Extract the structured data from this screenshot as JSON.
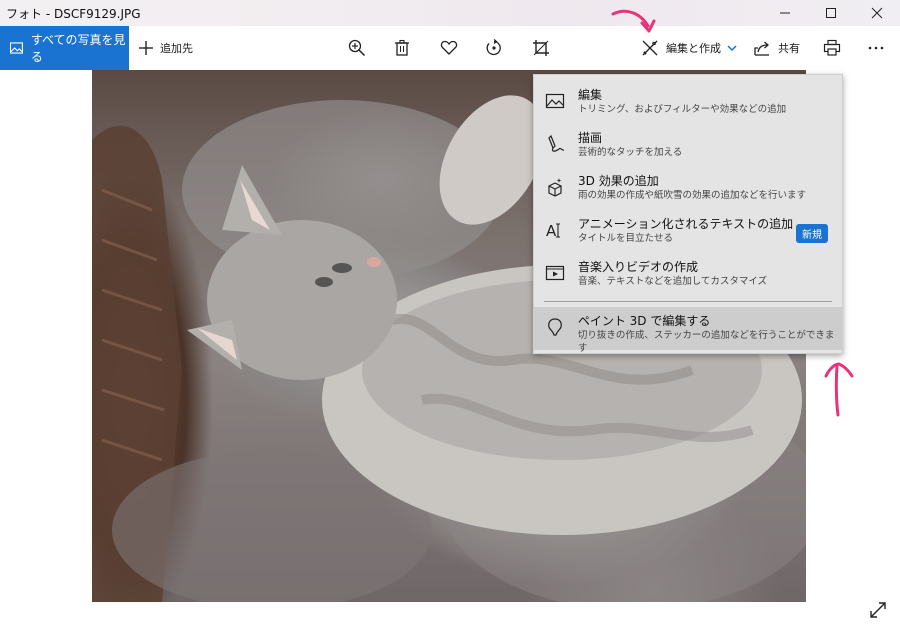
{
  "window": {
    "title": "フォト - DSCF9129.JPG",
    "minimize_icon": "minimize-icon",
    "maximize_icon": "maximize-icon",
    "close_icon": "close-icon"
  },
  "toolbar": {
    "all_photos_label": "すべての写真を見る",
    "add_to_label": "追加先",
    "edit_create_label": "編集と作成",
    "share_label": "共有",
    "icons": [
      "zoom-in-icon",
      "delete-icon",
      "heart-icon",
      "rotate-icon",
      "crop-icon",
      "print-icon",
      "more-icon"
    ]
  },
  "menu": {
    "items": [
      {
        "title": "編集",
        "desc": "トリミング、およびフィルターや効果などの追加",
        "icon": "edit-photo-icon"
      },
      {
        "title": "描画",
        "desc": "芸術的なタッチを加える",
        "icon": "draw-icon"
      },
      {
        "title": "3D 効果の追加",
        "desc": "雨の効果の作成や紙吹雪の効果の追加などを行います",
        "icon": "3d-effects-icon"
      },
      {
        "title": "アニメーション化されるテキストの追加",
        "desc": "タイトルを目立たせる",
        "icon": "animated-text-icon",
        "badge": "新規"
      },
      {
        "title": "音楽入りビデオの作成",
        "desc": "音楽、テキストなどを追加してカスタマイズ",
        "icon": "video-icon"
      },
      {
        "title": "ペイント 3D で編集する",
        "desc": "切り抜きの作成、ステッカーの追加などを行うことができます",
        "icon": "paint3d-icon"
      }
    ]
  },
  "colors": {
    "accent": "#1a73d1",
    "annotation": "#e8337a",
    "menu_bg": "#e4e4e4"
  }
}
